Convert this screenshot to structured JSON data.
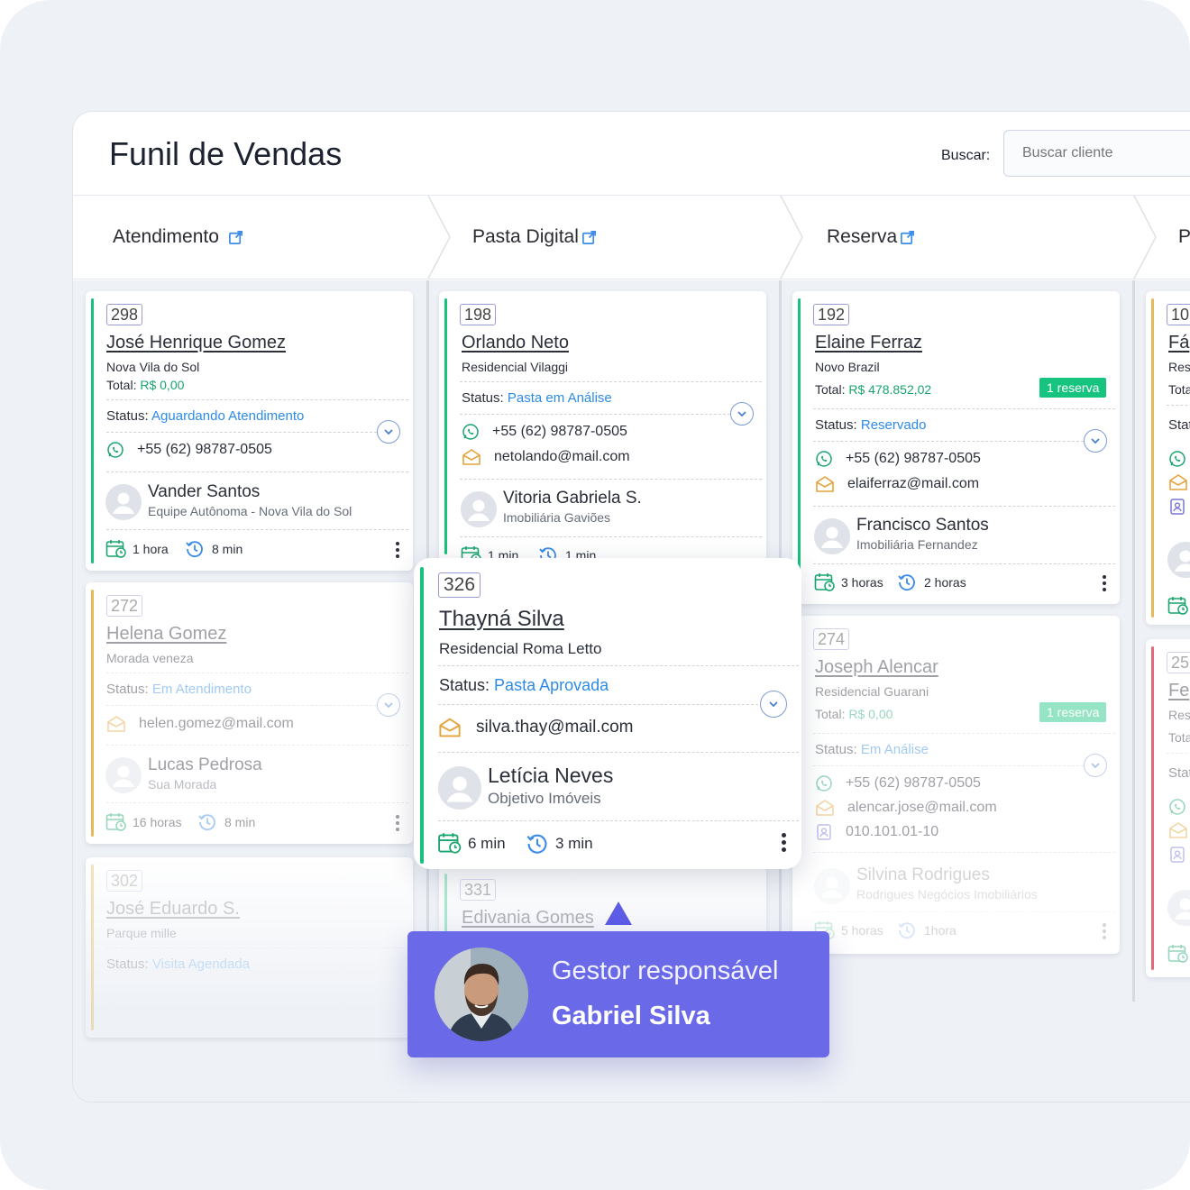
{
  "header": {
    "title": "Funil de Vendas",
    "search_label": "Buscar:",
    "search_placeholder": "Buscar cliente"
  },
  "stages": [
    {
      "label": "Atendimento"
    },
    {
      "label": "Pasta Digital"
    },
    {
      "label": "Reserva"
    },
    {
      "label": "P"
    }
  ],
  "colors": {
    "green": "#19c27c",
    "yellow": "#e6b95a",
    "red": "#e06a7a",
    "blue": "#2d8be8",
    "accent": "#6a6ae8"
  },
  "cards": {
    "c298": {
      "num": "298",
      "name": "José Henrique Gomez",
      "address": "Nova  Vila do Sol",
      "total_label": "Total:",
      "total": "R$ 0,00",
      "status_label": "Status:",
      "status": "Aguardando Atendimento",
      "phone": "+55 (62) 98787-0505",
      "agent": "Vander Santos",
      "agency": "Equipe Autônoma - Nova Vila do Sol",
      "t1": "1 hora",
      "t2": "8 min"
    },
    "c272": {
      "num": "272",
      "name": "Helena Gomez",
      "address": "Morada veneza",
      "status_label": "Status:",
      "status": "Em Atendimento",
      "email": "helen.gomez@mail.com",
      "agent": "Lucas Pedrosa",
      "agency": "Sua Morada",
      "t1": "16 horas",
      "t2": "8 min"
    },
    "c302": {
      "num": "302",
      "name": "José Eduardo S.",
      "address": "Parque mille",
      "status_label": "Status:",
      "status": "Visita Agendada"
    },
    "c198": {
      "num": "198",
      "name": "Orlando Neto",
      "address": "Residencial Vilaggi",
      "status_label": "Status:",
      "status": "Pasta em Análise",
      "phone": "+55 (62) 98787-0505",
      "email": "netolando@mail.com",
      "agent": "Vitoria Gabriela S.",
      "agency": "Imobiliária Gaviões",
      "t1": "1 min",
      "t2": "1 min"
    },
    "c331": {
      "num": "331",
      "name": "Edivania Gomes"
    },
    "c192": {
      "num": "192",
      "name": "Elaine Ferraz",
      "address": "Novo Brazil",
      "total_label": "Total:",
      "total": "R$ 478.852,02",
      "badge": "1 reserva",
      "status_label": "Status:",
      "status": "Reservado",
      "phone": "+55 (62) 98787-0505",
      "email": "elaiferraz@mail.com",
      "agent": "Francisco Santos",
      "agency": "Imobiliária Fernandez",
      "t1": "3 horas",
      "t2": "2 horas"
    },
    "c274": {
      "num": "274",
      "name": "Joseph Alencar",
      "address": "Residencial Guarani",
      "total_label": "Total:",
      "total": "R$ 0,00",
      "badge": "1 reserva",
      "status_label": "Status:",
      "status": "Em Análise",
      "phone": "+55 (62) 98787-0505",
      "email": "alencar.jose@mail.com",
      "doc": "010.101.01-10",
      "agent": "Silvina Rodrigues",
      "agency": "Rodrigues Negócios Imobiliários",
      "t1": "5 horas",
      "t2": "1hora"
    },
    "c10": {
      "num": "10",
      "name": "Fá",
      "address": "Res",
      "total_label": "Tota",
      "status_label": "Stat"
    },
    "c25": {
      "num": "25",
      "name": "Fe",
      "address": "Res",
      "total_label": "Tota",
      "status_label": "Stat"
    }
  },
  "featured": {
    "num": "326",
    "name": "Thayná Silva",
    "address": "Residencial Roma Letto",
    "status_label": "Status:",
    "status": "Pasta Aprovada",
    "email": "silva.thay@mail.com",
    "agent": "Letícia Neves",
    "agency": "Objetivo Imóveis",
    "t1": "6 min",
    "t2": "3 min"
  },
  "tooltip": {
    "line1": "Gestor responsável",
    "line2": "Gabriel Silva"
  }
}
